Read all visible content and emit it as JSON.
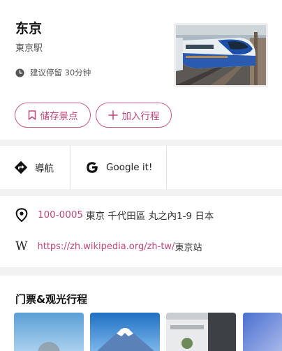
{
  "place": {
    "title": "东京",
    "subtitle": "東京駅",
    "stay_label": "建议停留 30分钟",
    "photo_alt": "新干线列车"
  },
  "buttons": {
    "save_label": "储存景点",
    "add_label": "加入行程"
  },
  "actions": {
    "navigate_label": "導航",
    "google_label": "Google it!"
  },
  "info": {
    "postal_code": "100-0005",
    "address": "東京 千代田區 丸之內1-9 日本",
    "wiki_url_prefix": "https://zh.wikipedia.org/zh-tw/",
    "wiki_url_page": "東京站"
  },
  "tickets": {
    "title": "门票&观光行程",
    "items": [
      "ticket-1",
      "ticket-2",
      "ticket-3",
      "ticket-4"
    ]
  },
  "colors": {
    "accent": "#c0467a",
    "background": "#f2f2f2",
    "card": "#ffffff"
  }
}
